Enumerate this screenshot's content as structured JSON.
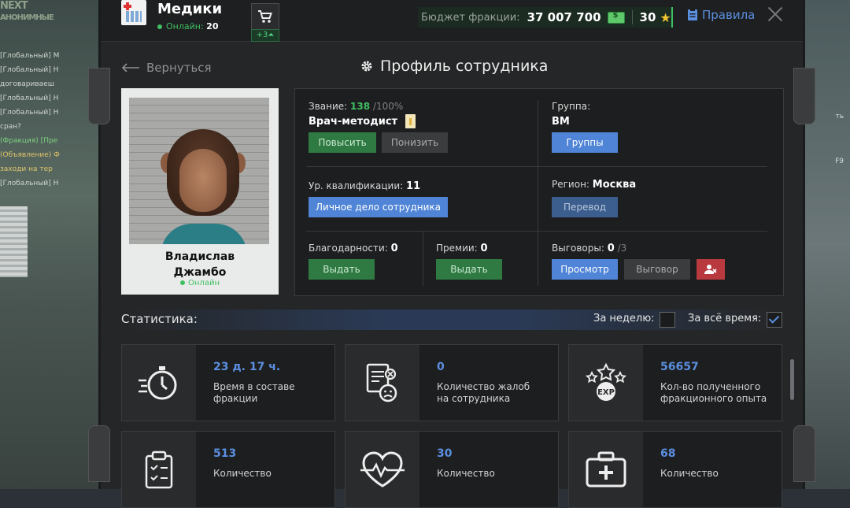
{
  "background": {
    "chat_lines": [
      "[Глобальный] М",
      "[Глобальный] Н",
      "договариваеш",
      "[Глобальный] Н",
      "[Глобальный] Н",
      "сран?",
      "(Фракция) [Пре",
      "(Объявление) Ф",
      "заходи на тер",
      "[Глобальный] Н"
    ],
    "logo_text": [
      "NEXT",
      "АНОНИМНЫЕ"
    ],
    "right_labels": [
      "ть",
      "F9"
    ]
  },
  "header": {
    "faction_name": "Медики",
    "online_label": "Онлайн:",
    "online_count": "20",
    "cart_badge": "+3",
    "budget_label": "Бюджет фракции:",
    "budget_value": "37 007 700",
    "stars_value": "30",
    "rules_label": "Правила"
  },
  "nav": {
    "back_label": "Вернуться",
    "page_title": "Профиль сотрудника"
  },
  "employee": {
    "first_name": "Владислав",
    "last_name": "Джамбо",
    "status": "Онлайн"
  },
  "profile": {
    "rank_label": "Звание:",
    "rank_value": "138",
    "rank_max": "/100%",
    "rank_title": "Врач-методист",
    "promote_label": "Повысить",
    "demote_label": "Понизить",
    "group_label": "Группа:",
    "group_value": "ВМ",
    "groups_button": "Группы",
    "qualification_label": "Ур. квалификации:",
    "qualification_value": "11",
    "personal_file_button": "Личное дело сотрудника",
    "region_label": "Регион:",
    "region_value": "Москва",
    "transfer_button": "Перевод",
    "thanks_label": "Благодарности:",
    "thanks_value": "0",
    "thanks_button": "Выдать",
    "bonus_label": "Премии:",
    "bonus_value": "0",
    "bonus_button": "Выдать",
    "reprimand_label": "Выговоры:",
    "reprimand_value": "0",
    "reprimand_max": "/3",
    "view_button": "Просмотр",
    "reprimand_button": "Выговор"
  },
  "stats": {
    "title": "Статистика:",
    "week_label": "За неделю:",
    "all_time_label": "За всё время:",
    "week_checked": false,
    "all_time_checked": true,
    "cards": [
      {
        "value": "23 д. 17 ч.",
        "desc1": "Время в составе",
        "desc2": "фракции",
        "icon": "stopwatch-icon"
      },
      {
        "value": "0",
        "desc1": "Количество жалоб",
        "desc2": "на сотрудника",
        "icon": "complaint-icon"
      },
      {
        "value": "56657",
        "desc1": "Кол-во полученного",
        "desc2": "фракционного опыта",
        "icon": "exp-icon"
      },
      {
        "value": "513",
        "desc1": "Количество",
        "desc2": "",
        "icon": "clipboard-icon"
      },
      {
        "value": "30",
        "desc1": "Количество",
        "desc2": "",
        "icon": "heartbeat-icon"
      },
      {
        "value": "68",
        "desc1": "Количество",
        "desc2": "",
        "icon": "medkit-icon"
      }
    ]
  },
  "colors": {
    "accent_blue": "#4f84d6",
    "accent_green": "#3fbf62",
    "danger_red": "#b83a3f",
    "panel_bg": "#252627"
  }
}
